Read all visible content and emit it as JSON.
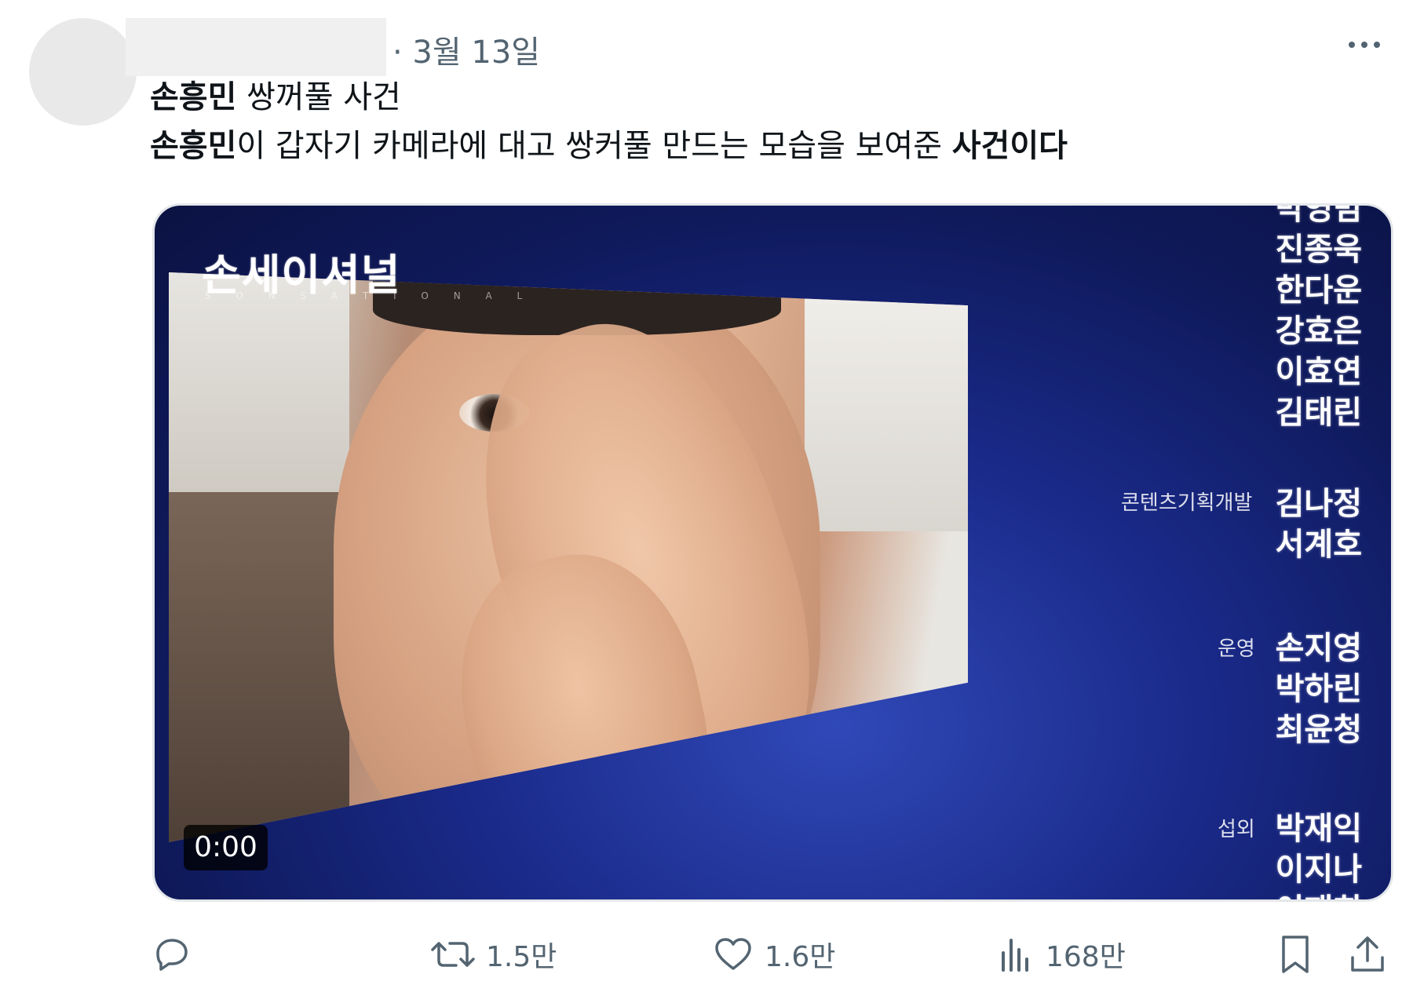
{
  "post": {
    "date": "· 3월 13일",
    "text_line1_bold": "손흥민",
    "text_line1_rest": " 쌍꺼풀 사건",
    "text_line2_bold1": "손흥민",
    "text_line2_mid": "이 갑자기 카메라에 대고 쌍커풀 만드는 모습을 보여준 ",
    "text_line2_bold2": "사건이다"
  },
  "media": {
    "logo": "손세이셔널",
    "logo_sub": "S O N S A T I O N A L",
    "timestamp": "0:00",
    "credits": [
      {
        "role": "",
        "names": [
          "박영범",
          "진종욱",
          "한다운",
          "강효은",
          "이효연",
          "김태린"
        ]
      },
      {
        "role": "콘텐츠기획개발",
        "names": [
          "김나정",
          "서계호"
        ]
      },
      {
        "role": "운영",
        "names": [
          "손지영",
          "박하린",
          "최윤청"
        ]
      },
      {
        "role": "섭외",
        "names": [
          "박재익",
          "이지나",
          "이재희"
        ]
      }
    ]
  },
  "actions": {
    "retweets": "1.5만",
    "likes": "1.6만",
    "views": "168만"
  },
  "icons": {
    "more": "more-horizontal-icon",
    "reply": "reply-icon",
    "retweet": "retweet-icon",
    "like": "heart-icon",
    "views": "views-chart-icon",
    "bookmark": "bookmark-icon",
    "share": "share-icon"
  },
  "colors": {
    "text": "#0f1419",
    "muted": "#536471",
    "video_bg": "#1a2a8a"
  }
}
